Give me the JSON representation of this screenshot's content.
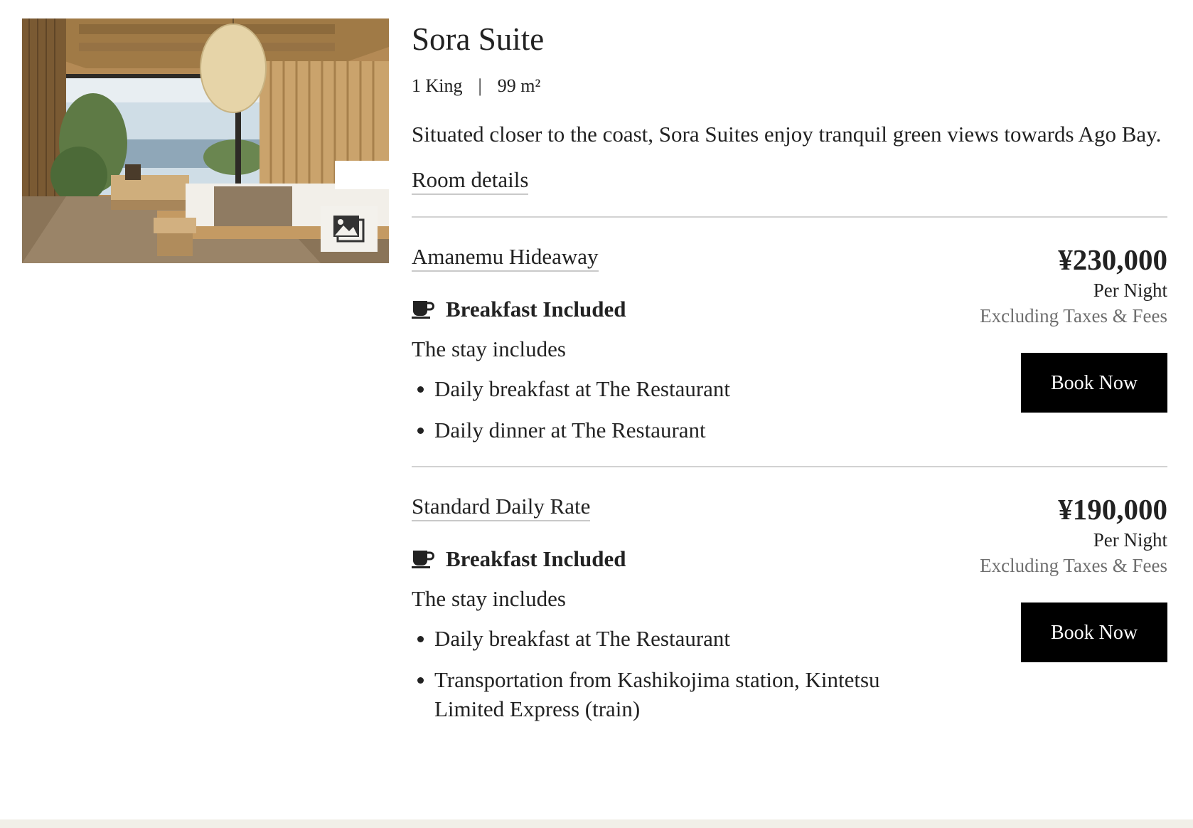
{
  "room": {
    "title": "Sora Suite",
    "bed": "1 King",
    "separator": "|",
    "size": "99 m²",
    "description": "Situated closer to the coast, Sora Suites enjoy tranquil green views towards Ago Bay.",
    "details_link": "Room details",
    "image_icon": "image-gallery-icon"
  },
  "rates": [
    {
      "name": "Amanemu Hideaway",
      "meal_icon": "coffee-cup-icon",
      "meal": "Breakfast Included",
      "stay_intro": "The stay includes",
      "inclusions": [
        "Daily breakfast at The Restaurant",
        "Daily dinner at The Restaurant"
      ],
      "price": "¥230,000",
      "per_night": "Per Night",
      "tax_note": "Excluding Taxes & Fees",
      "book_label": "Book Now"
    },
    {
      "name": "Standard Daily Rate",
      "meal_icon": "coffee-cup-icon",
      "meal": "Breakfast Included",
      "stay_intro": "The stay includes",
      "inclusions": [
        "Daily breakfast at The Restaurant",
        "Transportation from Kashikojima station, Kintetsu Limited Express (train)"
      ],
      "price": "¥190,000",
      "per_night": "Per Night",
      "tax_note": "Excluding Taxes & Fees",
      "book_label": "Book Now"
    }
  ],
  "colors": {
    "text": "#222222",
    "muted": "#6e6e6e",
    "button_bg": "#000000",
    "button_text": "#ffffff",
    "divider": "#d2d2d2",
    "page_footer_band": "#f1efe8"
  }
}
